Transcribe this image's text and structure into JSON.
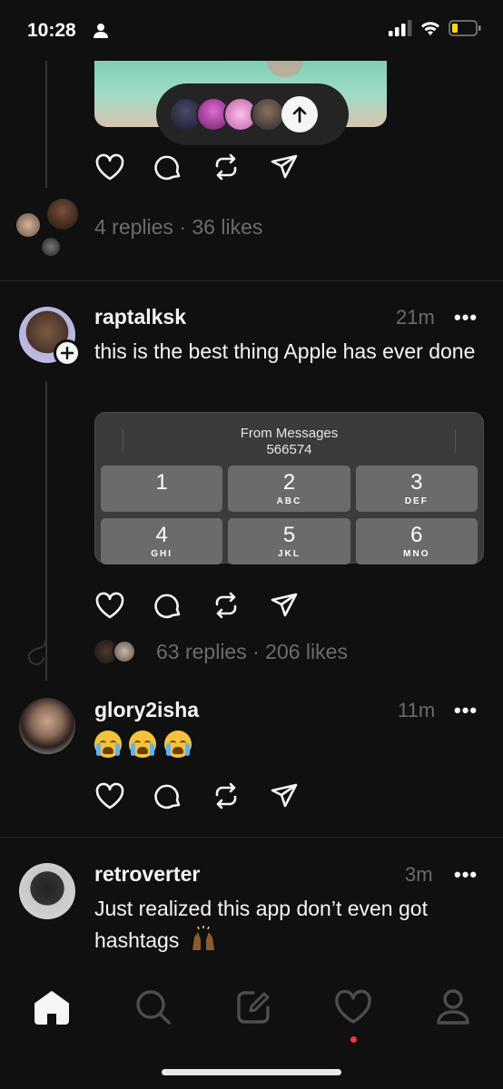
{
  "status_bar": {
    "time": "10:28"
  },
  "post1": {
    "replies_likes": "4 replies · 36 likes"
  },
  "post2": {
    "username": "raptalksk",
    "time": "21m",
    "more": "•••",
    "text": "this is the best thing Apple has ever done",
    "keypad": {
      "header": "From Messages",
      "code": "566574",
      "keys": [
        {
          "num": "1",
          "letters": ""
        },
        {
          "num": "2",
          "letters": "ABC"
        },
        {
          "num": "3",
          "letters": "DEF"
        },
        {
          "num": "4",
          "letters": "GHI"
        },
        {
          "num": "5",
          "letters": "JKL"
        },
        {
          "num": "6",
          "letters": "MNO"
        }
      ]
    },
    "replies_likes": "63 replies · 206 likes"
  },
  "post3": {
    "username": "glory2isha",
    "time": "11m",
    "more": "•••"
  },
  "post4": {
    "username": "retroverter",
    "time": "3m",
    "more": "•••",
    "text_line1": "Just realized this app don’t even got",
    "text_line2": "hashtags"
  },
  "icons": [
    "person-icon",
    "signal-icon",
    "wifi-icon",
    "battery-icon",
    "heart-icon",
    "comment-icon",
    "repost-icon",
    "share-icon",
    "home-icon",
    "search-icon",
    "compose-icon",
    "activity-icon",
    "profile-icon",
    "arrow-up-icon",
    "plus-icon"
  ],
  "colors": {
    "background": "#101010",
    "text": "#f3f5f7",
    "muted": "#6b6b6b",
    "notification_dot": "#ff3040"
  }
}
